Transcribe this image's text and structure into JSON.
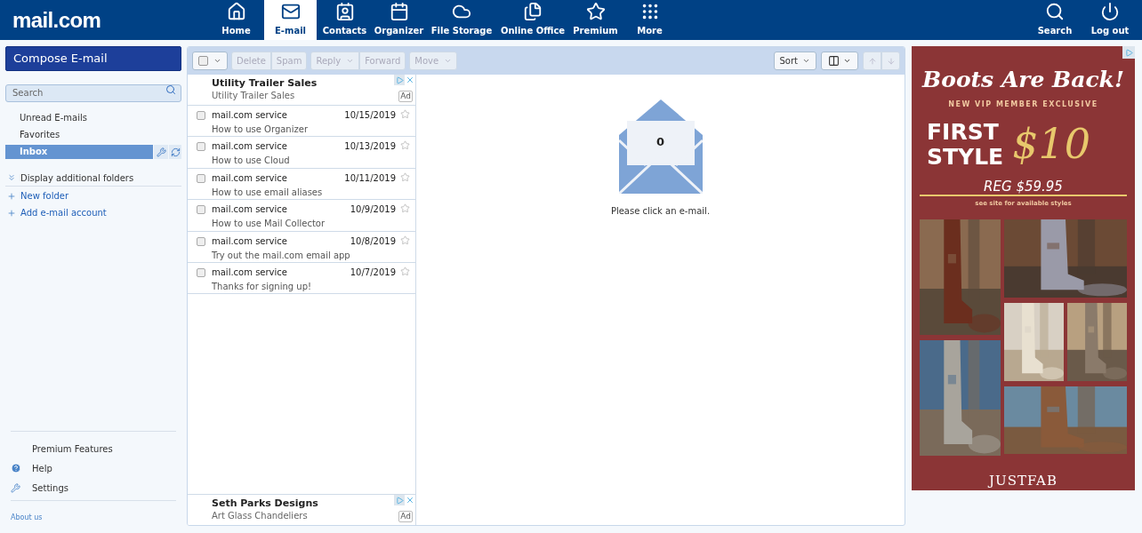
{
  "logo": "mail.com",
  "nav": [
    {
      "label": "Home",
      "selected": false
    },
    {
      "label": "E-mail",
      "selected": true
    },
    {
      "label": "Contacts",
      "selected": false
    },
    {
      "label": "Organizer",
      "selected": false
    },
    {
      "label": "File Storage",
      "selected": false
    },
    {
      "label": "Online Office",
      "selected": false
    },
    {
      "label": "Premium",
      "selected": false
    },
    {
      "label": "More",
      "selected": false
    }
  ],
  "nav_right": [
    "Search",
    "Log out"
  ],
  "sidebar": {
    "compose": "Compose E-mail",
    "search": {
      "placeholder": "Search"
    },
    "folders": [
      {
        "label": "Unread E-mails",
        "selected": false
      },
      {
        "label": "Favorites",
        "selected": false
      },
      {
        "label": "Inbox",
        "selected": true
      }
    ],
    "links": [
      {
        "label": "Display additional folders",
        "kind": "expand"
      },
      {
        "label": "New folder",
        "kind": "add"
      },
      {
        "label": "Add e-mail account",
        "kind": "add"
      }
    ],
    "footer": [
      {
        "label": "Premium Features",
        "kind": "plain"
      },
      {
        "label": "Help",
        "kind": "help"
      },
      {
        "label": "Settings",
        "kind": "settings"
      }
    ],
    "about": "About us"
  },
  "toolbar": {
    "select_all": {
      "checked": false
    },
    "groups": [
      [
        {
          "label": "Delete",
          "kind": "plain"
        },
        {
          "label": "Spam",
          "kind": "plain"
        }
      ],
      [
        {
          "label": "Reply",
          "kind": "dropdown"
        },
        {
          "label": "Forward",
          "kind": "plain"
        }
      ],
      [
        {
          "label": "Move",
          "kind": "dropdown"
        }
      ]
    ],
    "sort": "Sort"
  },
  "ads": [
    {
      "title": "Utility Trailer Sales",
      "subtitle": "Utility Trailer Sales",
      "badge": "Ad"
    },
    {
      "title": "Seth Parks Designs",
      "subtitle": "Art Glass Chandeliers",
      "badge": "Ad"
    }
  ],
  "emails": [
    {
      "sender": "mail.com service",
      "date": "10/15/2019",
      "subject": "How to use Organizer",
      "checked": false,
      "starred": false
    },
    {
      "sender": "mail.com service",
      "date": "10/13/2019",
      "subject": "How to use Cloud",
      "checked": false,
      "starred": false
    },
    {
      "sender": "mail.com service",
      "date": "10/11/2019",
      "subject": "How to use email aliases",
      "checked": false,
      "starred": false
    },
    {
      "sender": "mail.com service",
      "date": "10/9/2019",
      "subject": "How to use Mail Collector",
      "checked": false,
      "starred": false
    },
    {
      "sender": "mail.com service",
      "date": "10/8/2019",
      "subject": "Try out the mail.com email app",
      "checked": false,
      "starred": false
    },
    {
      "sender": "mail.com service",
      "date": "10/7/2019",
      "subject": "Thanks for signing up!",
      "checked": false,
      "starred": false
    }
  ],
  "preview": {
    "count": "0",
    "message": "Please click an e-mail."
  },
  "banner": {
    "headline": "Boots Are Back!",
    "tagline": "NEW VIP MEMBER EXCLUSIVE",
    "offer_line_1": "FIRST",
    "offer_line_2": "STYLE",
    "price": "$10",
    "regular_price": "REG $59.95",
    "note": "see site for available styles",
    "brand": "JUSTFAB"
  }
}
